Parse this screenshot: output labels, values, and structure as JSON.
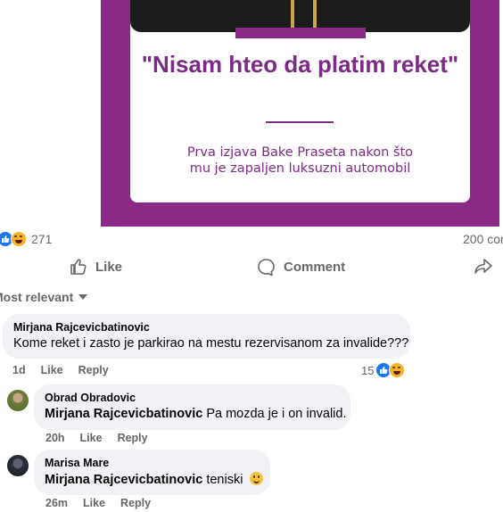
{
  "post": {
    "quote": "\"Nisam hteo da platim reket\"",
    "subtitle_line1": "Prva izjava Bake Praseta nakon što",
    "subtitle_line2": "mu je zapaljen luksuzni automobil"
  },
  "reactions": {
    "count": "271",
    "comments": "200 cor"
  },
  "actions": {
    "like": "Like",
    "comment": "Comment"
  },
  "sort": {
    "label": "Most relevant"
  },
  "comments": [
    {
      "author": "Mirjana Rajcevicbatinovic",
      "text": "Kome reket i zasto je parkirao na mestu rezervisanom za invalide???",
      "time": "1d",
      "like": "Like",
      "reply": "Reply",
      "reactions": "15"
    },
    {
      "author": "Obrad Obradovic",
      "mention": "Mirjana Rajcevicbatinovic",
      "text": "Pa mozda je i on invalid.",
      "time": "20h",
      "like": "Like",
      "reply": "Reply"
    },
    {
      "author": "Marisa Mare",
      "mention": "Mirjana Rajcevicbatinovic",
      "text": "teniski",
      "time": "26m",
      "like": "Like",
      "reply": "Reply"
    }
  ],
  "colors": {
    "brand_purple": "#8a2a86",
    "like_blue": "#1877f2",
    "muted": "#65676b",
    "bubble": "#f0f2f5"
  }
}
